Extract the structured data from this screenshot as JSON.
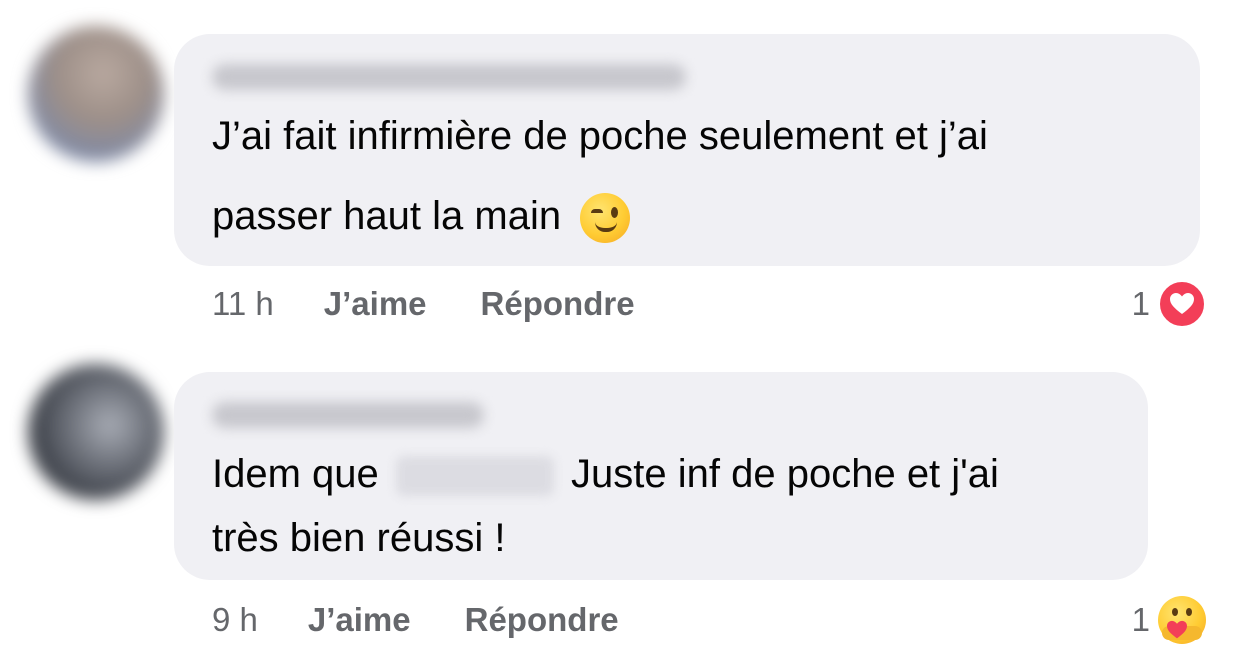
{
  "comments": [
    {
      "text_line1": "J’ai fait infirmière de poche seulement et j’ai",
      "text_line2": "passer haut la main",
      "emoji": "winking-face-emoji",
      "time": "11 h",
      "like_label": "J’aime",
      "reply_label": "Répondre",
      "reaction_count": "1",
      "reaction_icon": "love-reaction-icon",
      "reaction_color": "#f33e58"
    },
    {
      "text_before_mention": "Idem que",
      "text_after_mention": "Juste inf de poche et j'ai",
      "text_line2": "très bien réussi !",
      "time": "9 h",
      "like_label": "J’aime",
      "reply_label": "Répondre",
      "reaction_count": "1",
      "reaction_icon": "care-reaction-icon"
    }
  ],
  "colors": {
    "bubble_background": "#f0f0f4",
    "meta_text": "#65676b"
  }
}
